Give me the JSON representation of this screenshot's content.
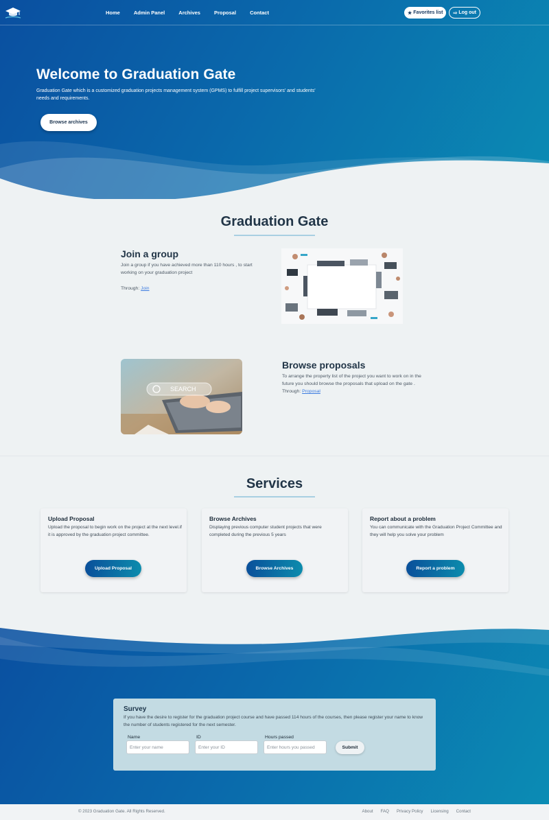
{
  "nav": {
    "links": [
      "Home",
      "Admin Panel",
      "Archives",
      "Proposal",
      "Contact"
    ],
    "favorites_label": "Favorites list",
    "logout_label": "Log out"
  },
  "hero": {
    "title": "Welcome to Graduation Gate",
    "description": "Graduation Gate which is a customized graduation projects management system (GPMS) to fulfill project supervisors' and students' needs and requirements.",
    "browse_label": "Browse archives"
  },
  "about": {
    "title": "Graduation Gate",
    "join": {
      "heading": "Join a group",
      "text": "Join a group if you have achieved more than 110 hours , to start working on your graduation project",
      "through": "Through:",
      "link": "Join"
    },
    "proposals": {
      "heading": "Browse proposals",
      "text": "To arrange the property list of the project you want to work on in the future you should browse the proposals that upload on the gate .",
      "through": "Through:",
      "link": "Proposal",
      "image_text": "SEARCH"
    }
  },
  "services": {
    "title": "Services",
    "cards": [
      {
        "title": "Upload Proposal",
        "text": "Upload the proposal to begin work on the project at the next level.if it is approved by the graduation project committee.",
        "button": "Upload Proposal"
      },
      {
        "title": "Browse Archives",
        "text": "Displaying previous computer student projects that were completed during the previous 5 years",
        "button": "Browse Archives"
      },
      {
        "title": "Report about a problem",
        "text": "You can communicate with the Graduation Project Committee and they will help you solve your problem",
        "button": "Report a problem"
      }
    ]
  },
  "survey": {
    "title": "Survey",
    "text": "If you have the desire to register for the graduation project course and have passed 114 hours of the courses, then please register your name to know the number of students registered for the next semester.",
    "fields": [
      {
        "label": "Name",
        "placeholder": "Enter your name"
      },
      {
        "label": "ID",
        "placeholder": "Enter your ID"
      },
      {
        "label": "Hours passed",
        "placeholder": "Enter hours you passed"
      }
    ],
    "submit": "Submit"
  },
  "footer": {
    "copyright": "© 2023 Graduation Gate. All Rights Reserved.",
    "links": [
      "About",
      "FAQ",
      "Privacy Policy",
      "Licensing",
      "Contact"
    ]
  },
  "colors": {
    "brand_dark": "#0a4fa0",
    "brand_light": "#0b8cb4",
    "heading": "#213547",
    "link": "#3b7be0"
  }
}
